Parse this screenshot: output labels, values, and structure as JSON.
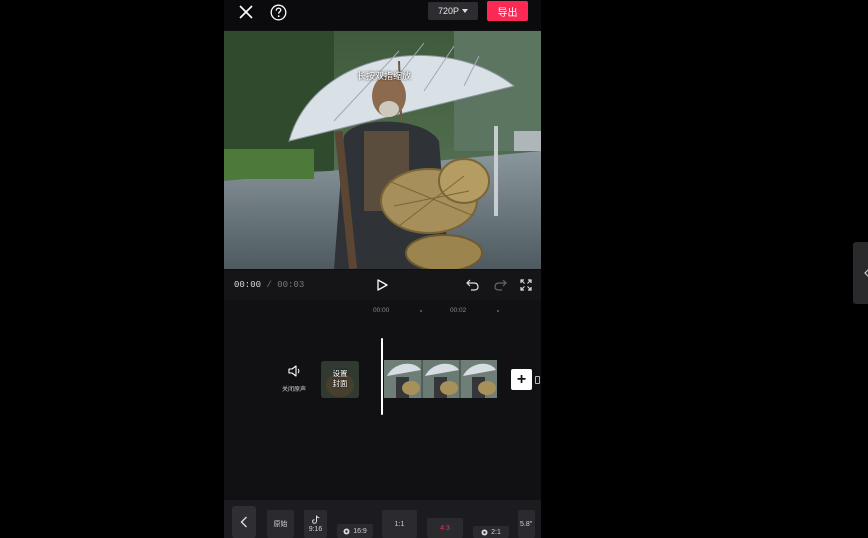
{
  "toolbar": {
    "close_icon": "close-icon",
    "help_icon": "help-icon",
    "resolution_label": "720P",
    "export_label": "导出"
  },
  "preview": {
    "caption": "长按双指缩放"
  },
  "playback": {
    "current_time": "00:00",
    "separator": "/",
    "duration": "00:03",
    "icons": [
      "play-icon",
      "undo-icon",
      "redo-icon",
      "fullscreen-icon"
    ]
  },
  "timeline": {
    "ruler_labels": [
      "00:00",
      "00:02"
    ],
    "mute_label": "关闭原声",
    "cover_label_line1": "设置",
    "cover_label_line2": "封面",
    "add_icon": "add-icon"
  },
  "ratio_tray": {
    "items": [
      {
        "label": "原始",
        "icon": ""
      },
      {
        "label": "9:16",
        "icon": "tiktok-icon"
      },
      {
        "label": "16:9",
        "icon": "dot-icon"
      },
      {
        "label": "1:1",
        "icon": ""
      },
      {
        "label": "4:3",
        "icon": ""
      },
      {
        "label": "2:1",
        "icon": "dot-icon"
      },
      {
        "label": "5.8\"",
        "icon": ""
      }
    ],
    "selected": "4:3"
  },
  "colors": {
    "accent": "#fa2a55",
    "background": "#101013",
    "panel": "#2d2d31"
  }
}
